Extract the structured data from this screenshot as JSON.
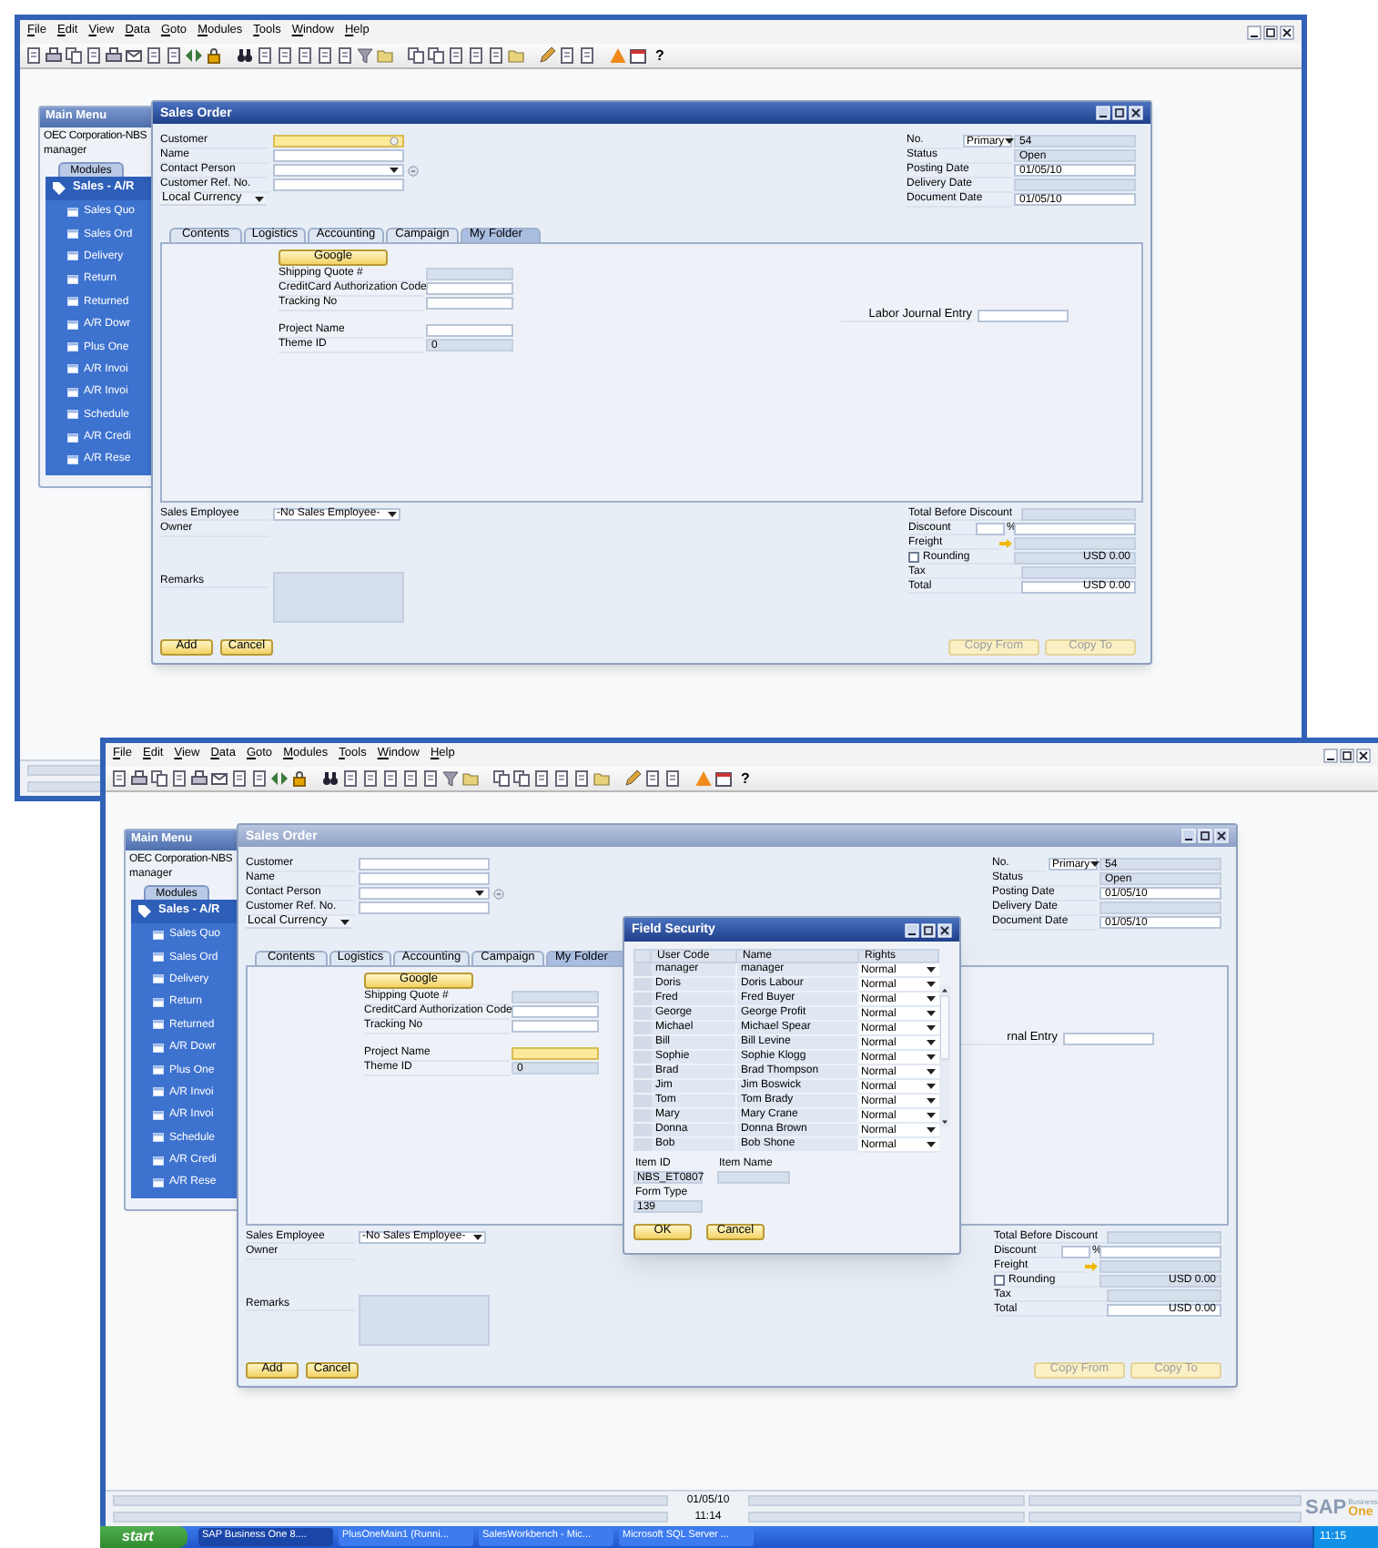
{
  "screens": [
    {
      "menu_bar": [
        "File",
        "Edit",
        "View",
        "Data",
        "Goto",
        "Modules",
        "Tools",
        "Window",
        "Help"
      ],
      "toolbar": {
        "help_label": "?"
      },
      "main_menu": {
        "title": "Main Menu",
        "company": "OEC Corporation-NBS",
        "user": "manager",
        "tabs": [
          {
            "label": "Modules",
            "selected": true
          }
        ],
        "module": "Sales - A/R",
        "items": [
          "Sales Quo",
          "Sales Ord",
          "Delivery",
          "Return",
          "Returned",
          "A/R Dowr",
          "Plus One",
          "A/R Invoi",
          "A/R Invoi",
          "Schedule",
          "A/R Credi",
          "A/R Rese"
        ]
      },
      "sales_order": {
        "title": "Sales Order",
        "active": true,
        "header_left": [
          {
            "label": "Customer",
            "kind": "lookup",
            "focused": true
          },
          {
            "label": "Name",
            "kind": "text",
            "focused": false
          },
          {
            "label": "Contact Person",
            "kind": "dropdown_link"
          },
          {
            "label": "Customer Ref. No.",
            "kind": "text",
            "focused": false
          }
        ],
        "currency": "Local Currency",
        "header_right": [
          {
            "label": "No.",
            "kind": "series",
            "series": "Primary",
            "value": "54"
          },
          {
            "label": "Status",
            "kind": "readonly",
            "value": "Open"
          },
          {
            "label": "Posting Date",
            "kind": "text",
            "value": "01/05/10",
            "focused": false
          },
          {
            "label": "Delivery Date",
            "kind": "readonly"
          },
          {
            "label": "Document Date",
            "kind": "text",
            "value": "01/05/10",
            "focused": false
          }
        ],
        "tabs": [
          {
            "label": "Contents",
            "selected": false
          },
          {
            "label": "Logistics",
            "selected": false
          },
          {
            "label": "Accounting",
            "selected": false
          },
          {
            "label": "Campaign",
            "selected": false
          },
          {
            "label": "My Folder",
            "selected": true
          }
        ],
        "folder": {
          "button": "Google",
          "field_groups": [
            [
              {
                "label": "Shipping Quote #",
                "kind": "readonly"
              },
              {
                "label": "CreditCard Authorization Code",
                "kind": "text",
                "focused": false
              },
              {
                "label": "Tracking No",
                "kind": "text",
                "focused": false
              }
            ],
            [
              {
                "label": "Project Name",
                "kind": "text",
                "focused": false
              },
              {
                "label": "Theme ID",
                "kind": "readonly",
                "value": "0"
              }
            ]
          ],
          "labor": {
            "label": "Labor Journal Entry",
            "kind": "text",
            "focused": false
          }
        },
        "sales_employee": {
          "label": "Sales Employee",
          "value": "-No Sales Employee-"
        },
        "owner": "Owner",
        "remarks": "Remarks",
        "totals": [
          {
            "label": "Total Before Discount",
            "kind": "readonly"
          },
          {
            "label": "Discount",
            "kind": "percent",
            "unit": "%"
          },
          {
            "label": "Freight",
            "kind": "arrow"
          },
          {
            "label": "Rounding",
            "kind": "checkbox",
            "checked": false,
            "value": "USD 0.00"
          },
          {
            "label": "Tax",
            "kind": "readonly"
          },
          {
            "label": "Total",
            "kind": "text",
            "value": "USD 0.00",
            "focused": false
          }
        ],
        "buttons_left": [
          {
            "label": "Add",
            "disabled": false
          },
          {
            "label": "Cancel",
            "disabled": false
          }
        ],
        "buttons_right": [
          {
            "label": "Copy From",
            "disabled": true
          },
          {
            "label": "Copy To",
            "disabled": true
          }
        ]
      }
    },
    {
      "menu_bar": [
        "File",
        "Edit",
        "View",
        "Data",
        "Goto",
        "Modules",
        "Tools",
        "Window",
        "Help"
      ],
      "toolbar": {
        "help_label": "?"
      },
      "main_menu": {
        "title": "Main Menu",
        "company": "OEC Corporation-NBS",
        "user": "manager",
        "tabs": [
          {
            "label": "Modules",
            "selected": true
          }
        ],
        "module": "Sales - A/R",
        "items": [
          "Sales Quo",
          "Sales Ord",
          "Delivery",
          "Return",
          "Returned",
          "A/R Dowr",
          "Plus One",
          "A/R Invoi",
          "A/R Invoi",
          "Schedule",
          "A/R Credi",
          "A/R Rese"
        ]
      },
      "sales_order": {
        "title": "Sales Order",
        "active": false,
        "header_left": [
          {
            "label": "Customer",
            "kind": "text",
            "focused": false
          },
          {
            "label": "Name",
            "kind": "text",
            "focused": false
          },
          {
            "label": "Contact Person",
            "kind": "dropdown_link"
          },
          {
            "label": "Customer Ref. No.",
            "kind": "text",
            "focused": false
          }
        ],
        "currency": "Local Currency",
        "header_right": [
          {
            "label": "No.",
            "kind": "series",
            "series": "Primary",
            "value": "54"
          },
          {
            "label": "Status",
            "kind": "readonly",
            "value": "Open"
          },
          {
            "label": "Posting Date",
            "kind": "text",
            "value": "01/05/10",
            "focused": false
          },
          {
            "label": "Delivery Date",
            "kind": "readonly"
          },
          {
            "label": "Document Date",
            "kind": "text",
            "value": "01/05/10",
            "focused": false
          }
        ],
        "tabs": [
          {
            "label": "Contents",
            "selected": false
          },
          {
            "label": "Logistics",
            "selected": false
          },
          {
            "label": "Accounting",
            "selected": false
          },
          {
            "label": "Campaign",
            "selected": false
          },
          {
            "label": "My Folder",
            "selected": true
          }
        ],
        "folder": {
          "button": "Google",
          "field_groups": [
            [
              {
                "label": "Shipping Quote #",
                "kind": "readonly"
              },
              {
                "label": "CreditCard Authorization Code",
                "kind": "text",
                "focused": false
              },
              {
                "label": "Tracking No",
                "kind": "text",
                "focused": false
              }
            ],
            [
              {
                "label": "Project Name",
                "kind": "text",
                "focused": true
              },
              {
                "label": "Theme ID",
                "kind": "readonly",
                "value": "0"
              }
            ]
          ],
          "labor": {
            "label": "rnal Entry",
            "kind": "text",
            "focused": false
          }
        },
        "sales_employee": {
          "label": "Sales Employee",
          "value": "-No Sales Employee-"
        },
        "owner": "Owner",
        "remarks": "Remarks",
        "totals": [
          {
            "label": "Total Before Discount",
            "kind": "readonly"
          },
          {
            "label": "Discount",
            "kind": "percent",
            "unit": "%"
          },
          {
            "label": "Freight",
            "kind": "arrow"
          },
          {
            "label": "Rounding",
            "kind": "checkbox",
            "checked": false,
            "value": "USD 0.00"
          },
          {
            "label": "Tax",
            "kind": "readonly"
          },
          {
            "label": "Total",
            "kind": "text",
            "value": "USD 0.00",
            "focused": false
          }
        ],
        "buttons_left": [
          {
            "label": "Add",
            "disabled": false
          },
          {
            "label": "Cancel",
            "disabled": false
          }
        ],
        "buttons_right": [
          {
            "label": "Copy From",
            "disabled": true
          },
          {
            "label": "Copy To",
            "disabled": true
          }
        ]
      },
      "dialog": {
        "title": "Field Security",
        "active": true,
        "columns": [
          "User Code",
          "Name",
          "Rights"
        ],
        "rows": [
          {
            "user_code": "manager",
            "name": "manager",
            "rights": "Normal"
          },
          {
            "user_code": "Doris",
            "name": "Doris Labour",
            "rights": "Normal"
          },
          {
            "user_code": "Fred",
            "name": "Fred Buyer",
            "rights": "Normal"
          },
          {
            "user_code": "George",
            "name": "George Profit",
            "rights": "Normal"
          },
          {
            "user_code": "Michael",
            "name": "Michael Spear",
            "rights": "Normal"
          },
          {
            "user_code": "Bill",
            "name": "Bill Levine",
            "rights": "Normal"
          },
          {
            "user_code": "Sophie",
            "name": "Sophie Klogg",
            "rights": "Normal"
          },
          {
            "user_code": "Brad",
            "name": "Brad Thompson",
            "rights": "Normal"
          },
          {
            "user_code": "Jim",
            "name": "Jim Boswick",
            "rights": "Normal"
          },
          {
            "user_code": "Tom",
            "name": "Tom Brady",
            "rights": "Normal"
          },
          {
            "user_code": "Mary",
            "name": "Mary Crane",
            "rights": "Normal"
          },
          {
            "user_code": "Donna",
            "name": "Donna Brown",
            "rights": "Normal"
          },
          {
            "user_code": "Bob",
            "name": "Bob Shone",
            "rights": "Normal"
          }
        ],
        "item_id_label": "Item ID",
        "item_id": "NBS_ET0807",
        "item_name_label": "Item Name",
        "form_type_label": "Form Type",
        "form_type": "139",
        "buttons": [
          "OK",
          "Cancel"
        ]
      },
      "status_bar": {
        "date": "01/05/10",
        "time": "11:14"
      },
      "logo": {
        "brand": "SAP",
        "line1": "Business",
        "line2": "One"
      },
      "taskbar": {
        "start": "start",
        "tasks": [
          {
            "label": "SAP Business One 8....",
            "selected": true
          },
          {
            "label": "PlusOneMain1 (Runni...",
            "selected": false
          },
          {
            "label": "SalesWorkbench - Mic...",
            "selected": false
          },
          {
            "label": "Microsoft SQL Server ...",
            "selected": false
          }
        ],
        "clock": "11:15"
      }
    }
  ]
}
